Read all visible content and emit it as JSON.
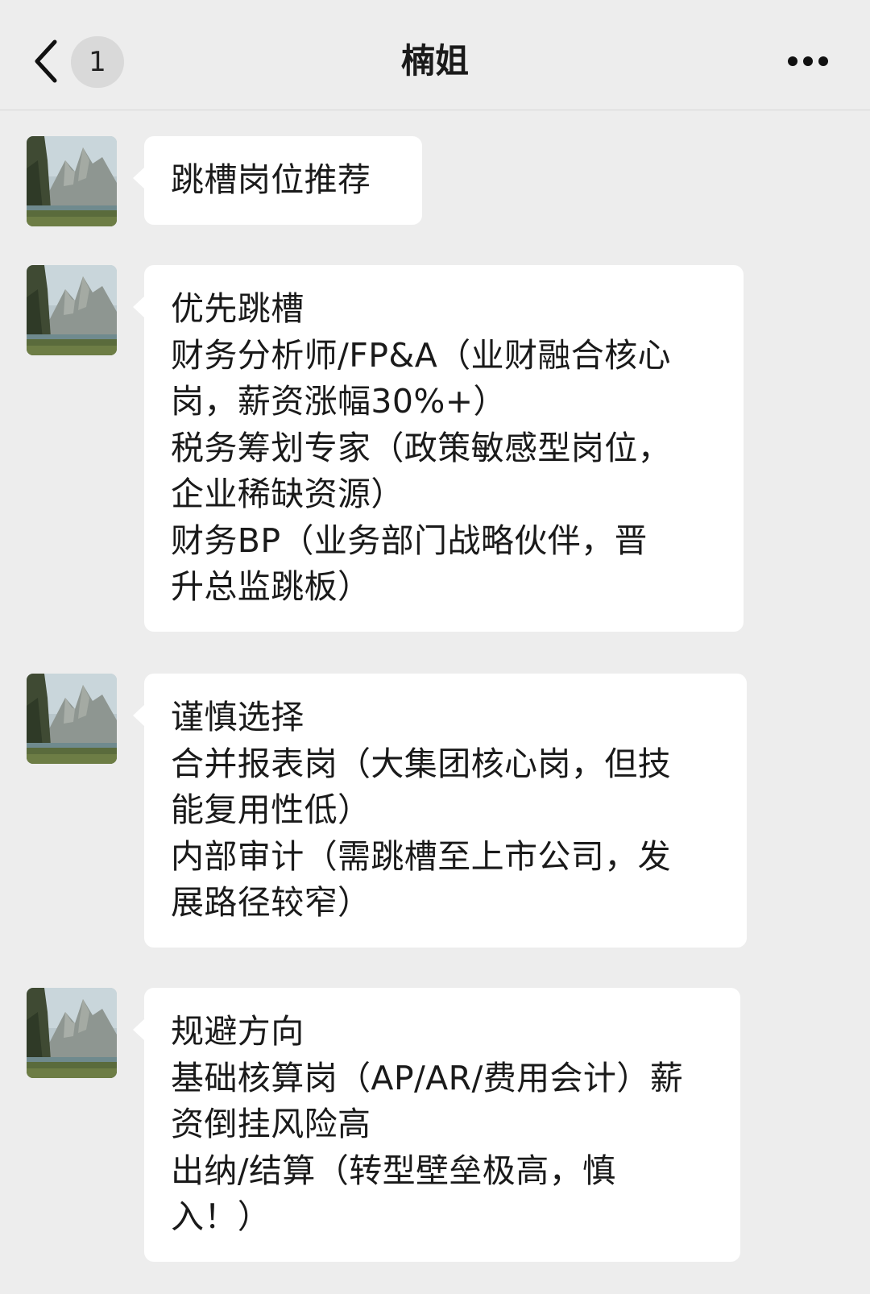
{
  "header": {
    "title": "楠姐",
    "unread_count": "1",
    "icons": {
      "back": "chevron-left-icon",
      "more": "more-dots-icon"
    }
  },
  "colors": {
    "background": "#ededed",
    "bubble": "#ffffff",
    "text": "#1a1a1a"
  },
  "messages": [
    {
      "lines": [
        "跳槽岗位推荐"
      ]
    },
    {
      "lines": [
        "优先跳槽",
        "财务分析师/FP&A（业财融合核心",
        "岗，薪资涨幅30%+）",
        "税务筹划专家（政策敏感型岗位，",
        "企业稀缺资源）",
        "财务BP（业务部门战略伙伴，晋",
        "升总监跳板）"
      ]
    },
    {
      "lines": [
        "谨慎选择",
        "合并报表岗（大集团核心岗，但技",
        "能复用性低）",
        "内部审计（需跳槽至上市公司，发",
        "展路径较窄）"
      ]
    },
    {
      "lines": [
        "规避方向",
        "基础核算岗（AP/AR/费用会计）薪",
        "资倒挂风险高",
        "出纳/结算（转型壁垒极高，慎",
        "入！）"
      ]
    }
  ]
}
